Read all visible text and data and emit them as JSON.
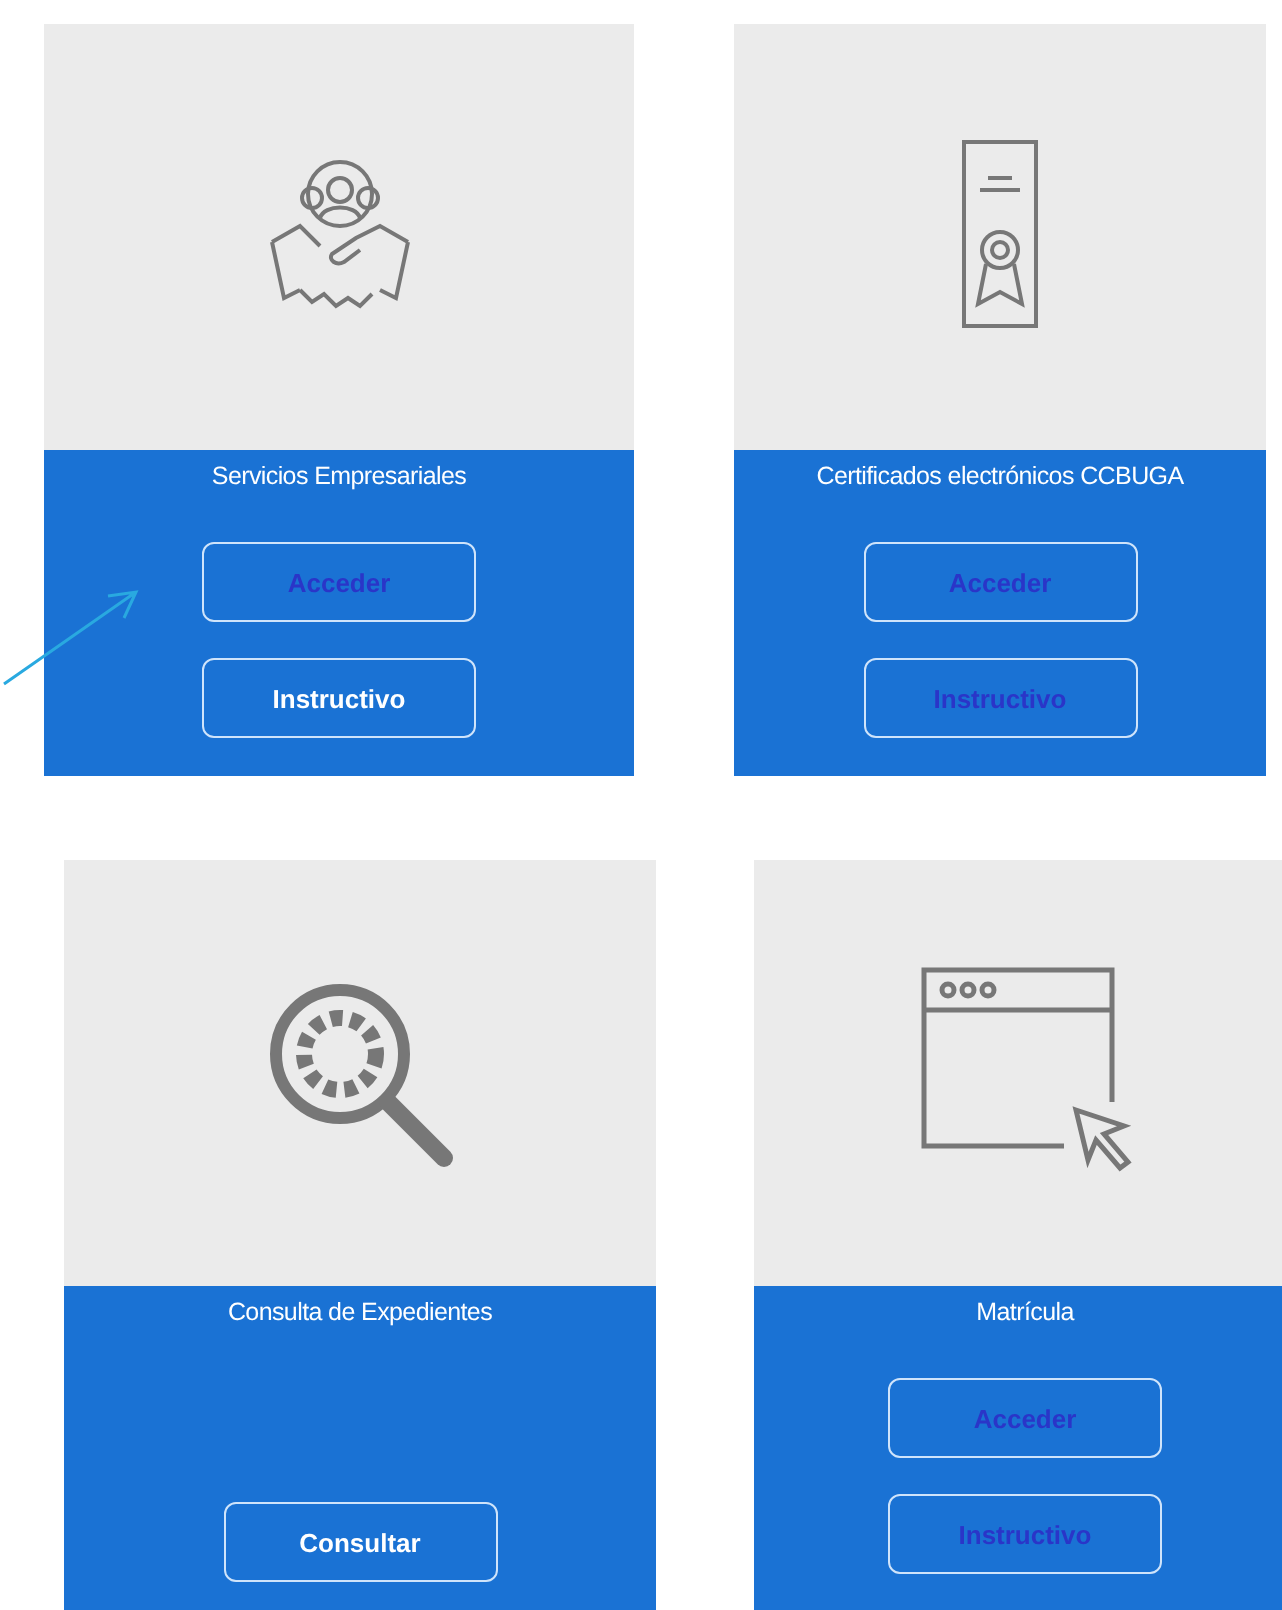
{
  "cards": [
    {
      "title": "Servicios Empresariales",
      "buttons": [
        {
          "label": "Acceder",
          "active": false
        },
        {
          "label": "Instructivo",
          "active": true
        }
      ]
    },
    {
      "title": "Certificados electrónicos CCBUGA",
      "buttons": [
        {
          "label": "Acceder",
          "active": false
        },
        {
          "label": "Instructivo",
          "active": false
        }
      ]
    },
    {
      "title": "Consulta de Expedientes",
      "buttons": [
        {
          "label": "Consultar",
          "active": true
        }
      ]
    },
    {
      "title": "Matrícula",
      "buttons": [
        {
          "label": "Acceder",
          "active": false
        },
        {
          "label": "Instructivo",
          "active": false
        }
      ]
    }
  ]
}
